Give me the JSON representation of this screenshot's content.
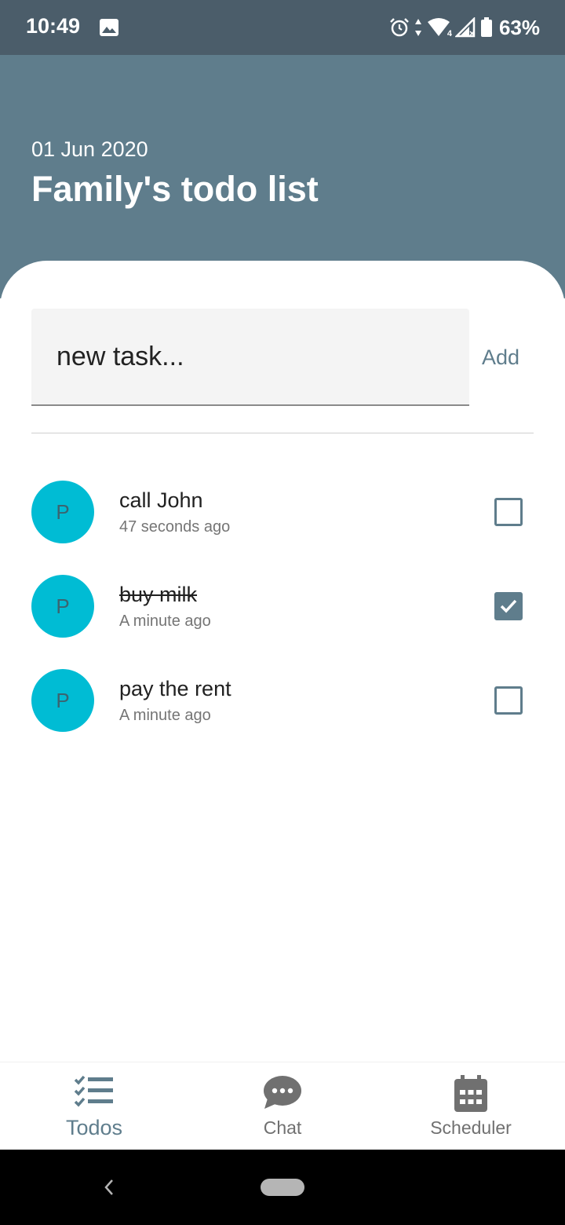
{
  "status_bar": {
    "time": "10:49",
    "battery_percent": "63%",
    "network_badge": "4",
    "icons": [
      "image-icon",
      "alarm-icon",
      "data-arrows-icon",
      "wifi-icon",
      "signal-icon",
      "battery-icon"
    ]
  },
  "header": {
    "date": "01 Jun 2020",
    "title": "Family's todo list"
  },
  "new_task": {
    "placeholder": "new task...",
    "add_label": "Add"
  },
  "todos": [
    {
      "avatar_letter": "P",
      "title": "call John",
      "time": "47 seconds ago",
      "done": false
    },
    {
      "avatar_letter": "P",
      "title": "buy milk",
      "time": "A minute ago",
      "done": true
    },
    {
      "avatar_letter": "P",
      "title": "pay the rent",
      "time": "A minute ago",
      "done": false
    }
  ],
  "bottom_nav": {
    "items": [
      {
        "label": "Todos",
        "icon": "checklist-icon",
        "active": true
      },
      {
        "label": "Chat",
        "icon": "chat-bubble-icon",
        "active": false
      },
      {
        "label": "Scheduler",
        "icon": "calendar-icon",
        "active": false
      }
    ]
  },
  "colors": {
    "status_bar": "#4b5d6a",
    "header": "#5f7d8c",
    "accent": "#5f7d8c",
    "avatar": "#00bcd4"
  }
}
